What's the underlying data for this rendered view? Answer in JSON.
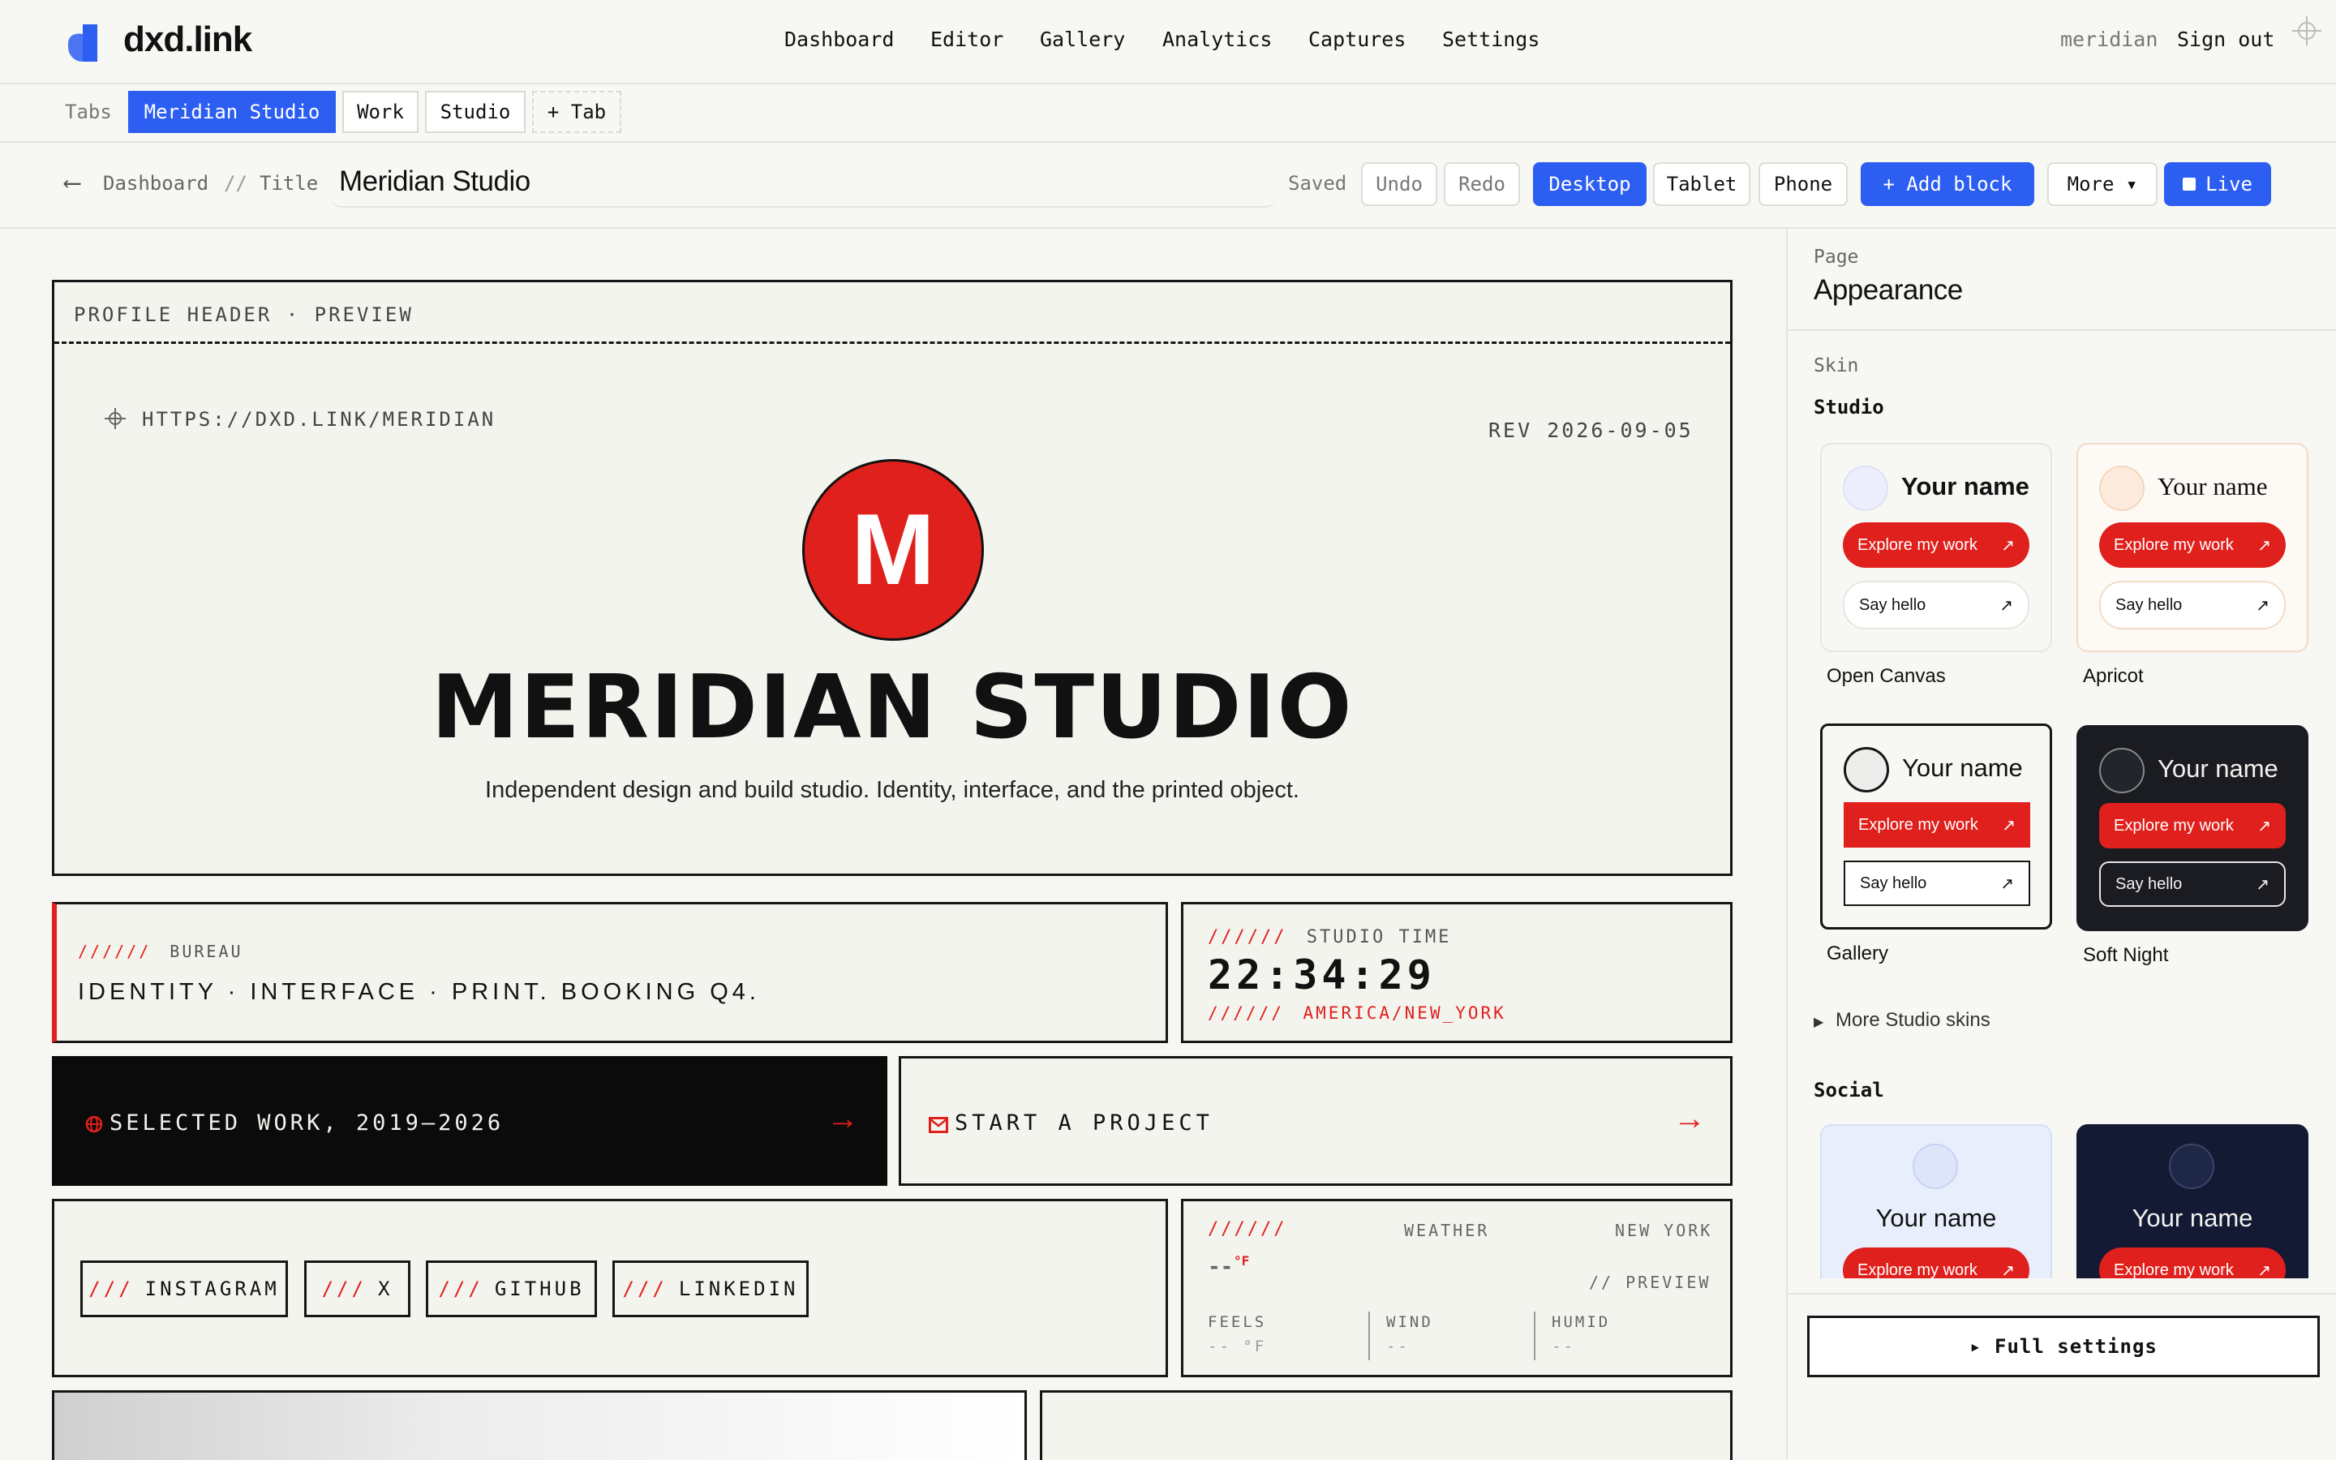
{
  "app": {
    "logo_text": "dxd.link",
    "nav": [
      "Dashboard",
      "Editor",
      "Gallery",
      "Analytics",
      "Captures",
      "Settings"
    ],
    "user": "meridian",
    "sign_out": "Sign out"
  },
  "tabs": {
    "label": "Tabs",
    "items": [
      "Meridian Studio",
      "Work",
      "Studio"
    ],
    "active_index": 0,
    "add_label": "+ Tab"
  },
  "toolbar": {
    "back_label": "Dashboard",
    "separator": "//",
    "title_label": "Title",
    "title_value": "Meridian Studio",
    "saved": "Saved",
    "undo": "Undo",
    "redo": "Redo",
    "devices": [
      "Desktop",
      "Tablet",
      "Phone"
    ],
    "active_device": "Desktop",
    "add_block": "+ Add block",
    "more": "More ▾",
    "live": "Live"
  },
  "canvas": {
    "header_label": "PROFILE HEADER · PREVIEW",
    "url": "HTTPS://DXD.LINK/MERIDIAN",
    "rev": "REV 2026-09-05",
    "avatar_letter": "M",
    "name": "MERIDIAN STUDIO",
    "bio": "Independent design and build studio. Identity, interface, and the printed object.",
    "bureau": {
      "slashes": "//////",
      "label": "BUREAU",
      "text": "IDENTITY · INTERFACE · PRINT. BOOKING Q4."
    },
    "studio_time": {
      "slashes": "//////",
      "label": "STUDIO TIME",
      "time": "22:34:29",
      "zone": "AMERICA/NEW_YORK"
    },
    "selected_work": "SELECTED WORK, 2019–2026",
    "start_project": "START A PROJECT",
    "socials": [
      {
        "prefix": "///",
        "name": "INSTAGRAM"
      },
      {
        "prefix": "///",
        "name": "X"
      },
      {
        "prefix": "///",
        "name": "GITHUB"
      },
      {
        "prefix": "///",
        "name": "LINKEDIN"
      }
    ],
    "weather": {
      "slashes": "//////",
      "label": "WEATHER",
      "city": "NEW YORK",
      "temp": "--",
      "unit": "°F",
      "preview": "// PREVIEW",
      "feels_label": "FEELS",
      "feels_value": "-- °F",
      "wind_label": "WIND",
      "wind_value": "--",
      "humid_label": "HUMID",
      "humid_value": "--"
    }
  },
  "sidebar": {
    "section_label": "Page",
    "title": "Appearance",
    "skin_label": "Skin",
    "group_studio": "Studio",
    "skins": [
      {
        "name": "Open Canvas",
        "your_name": "Your name",
        "primary": "Explore my work",
        "secondary": "Say hello"
      },
      {
        "name": "Apricot",
        "your_name": "Your name",
        "primary": "Explore my work",
        "secondary": "Say hello"
      },
      {
        "name": "Gallery",
        "your_name": "Your name",
        "primary": "Explore my work",
        "secondary": "Say hello"
      },
      {
        "name": "Soft Night",
        "your_name": "Your name",
        "primary": "Explore my work",
        "secondary": "Say hello"
      }
    ],
    "more_skins": "More Studio skins",
    "group_social": "Social",
    "social_skins": [
      {
        "your_name": "Your name",
        "primary": "Explore my work"
      },
      {
        "your_name": "Your name",
        "primary": "Explore my work"
      }
    ],
    "full_settings": "▸ Full settings"
  },
  "colors": {
    "accent_blue": "#2d5ef2",
    "accent_red": "#e0201c",
    "ink": "#111111",
    "paper": "#f4f4ef"
  }
}
